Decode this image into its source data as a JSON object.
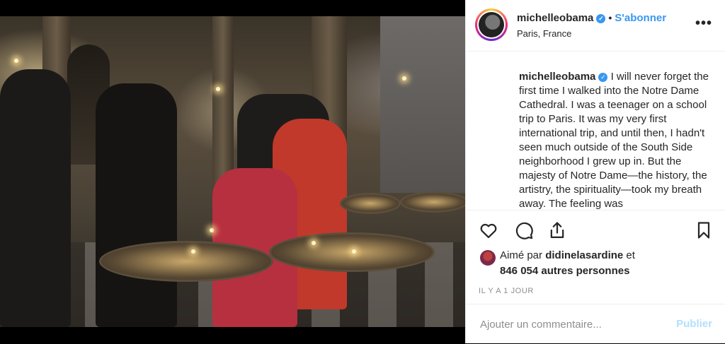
{
  "post": {
    "image_alt": "",
    "author": {
      "username": "michelleobama",
      "verified_icon": "verified-badge-icon",
      "follow_label": "S'abonner",
      "location": "Paris, France"
    },
    "more_label": "•••",
    "caption": {
      "username": "michelleobama",
      "text": "I will never forget the first time I walked into the Notre Dame Cathedral. I was a teenager on a school trip to Paris. It was my very first international trip, and until then, I hadn't seen much outside of the South Side neighborhood I grew up in. But the majesty of Notre Dame—the history, the artistry, the spirituality—took my breath away. The feeling was"
    },
    "actions": {
      "like_icon": "heart-icon",
      "comment_icon": "comment-icon",
      "share_icon": "share-icon",
      "save_icon": "bookmark-icon"
    },
    "likes": {
      "prefix": "Aimé par",
      "first_user": "didinelasardine",
      "conjunction": "et",
      "others": "846 054 autres personnes"
    },
    "timestamp": "IL Y A 1 JOUR",
    "comment": {
      "placeholder": "Ajouter un commentaire...",
      "post_label": "Publier"
    }
  },
  "colors": {
    "accent": "#3897f0",
    "text": "#262626",
    "muted": "#8e8e8e",
    "post_disabled": "#b2dffc"
  }
}
